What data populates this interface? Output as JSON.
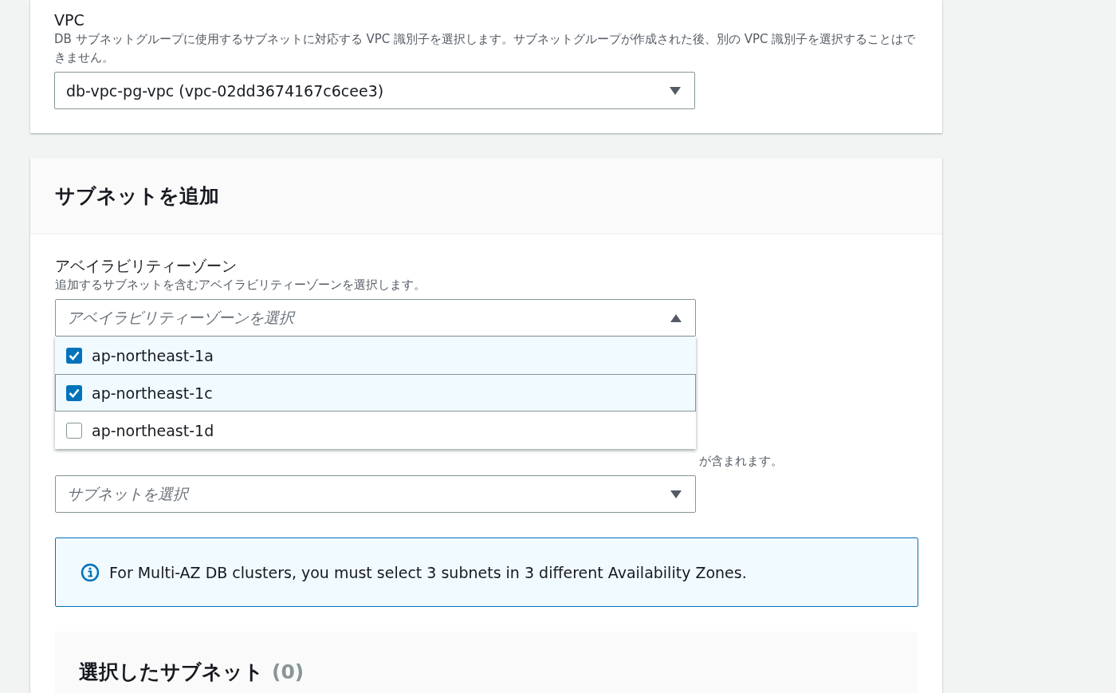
{
  "vpc_section": {
    "label": "VPC",
    "description": "DB サブネットグループに使用するサブネットに対応する VPC 識別子を選択します。サブネットグループが作成された後、別の VPC 識別子を選択することはできません。",
    "select": {
      "value": "db-vpc-pg-vpc (vpc-02dd3674167c6cee3)",
      "expanded": false
    }
  },
  "add_subnets": {
    "title": "サブネットを追加",
    "availability_zone": {
      "label": "アベイラビリティーゾーン",
      "description": "追加するサブネットを含むアベイラビリティーゾーンを選択します。",
      "select": {
        "placeholder": "アベイラビリティーゾーンを選択",
        "expanded": true
      },
      "options": [
        {
          "label": "ap-northeast-1a",
          "checked": true,
          "focused": false
        },
        {
          "label": "ap-northeast-1c",
          "checked": true,
          "focused": true
        },
        {
          "label": "ap-northeast-1d",
          "checked": false,
          "focused": false
        }
      ]
    },
    "subnets": {
      "description_visible": "が含まれます。",
      "select": {
        "placeholder": "サブネットを選択",
        "expanded": false
      }
    },
    "info": "For Multi-AZ DB clusters, you must select 3 subnets in 3 different Availability Zones.",
    "selected_subnets": {
      "title": "選択したサブネット",
      "count": "(0)"
    }
  }
}
